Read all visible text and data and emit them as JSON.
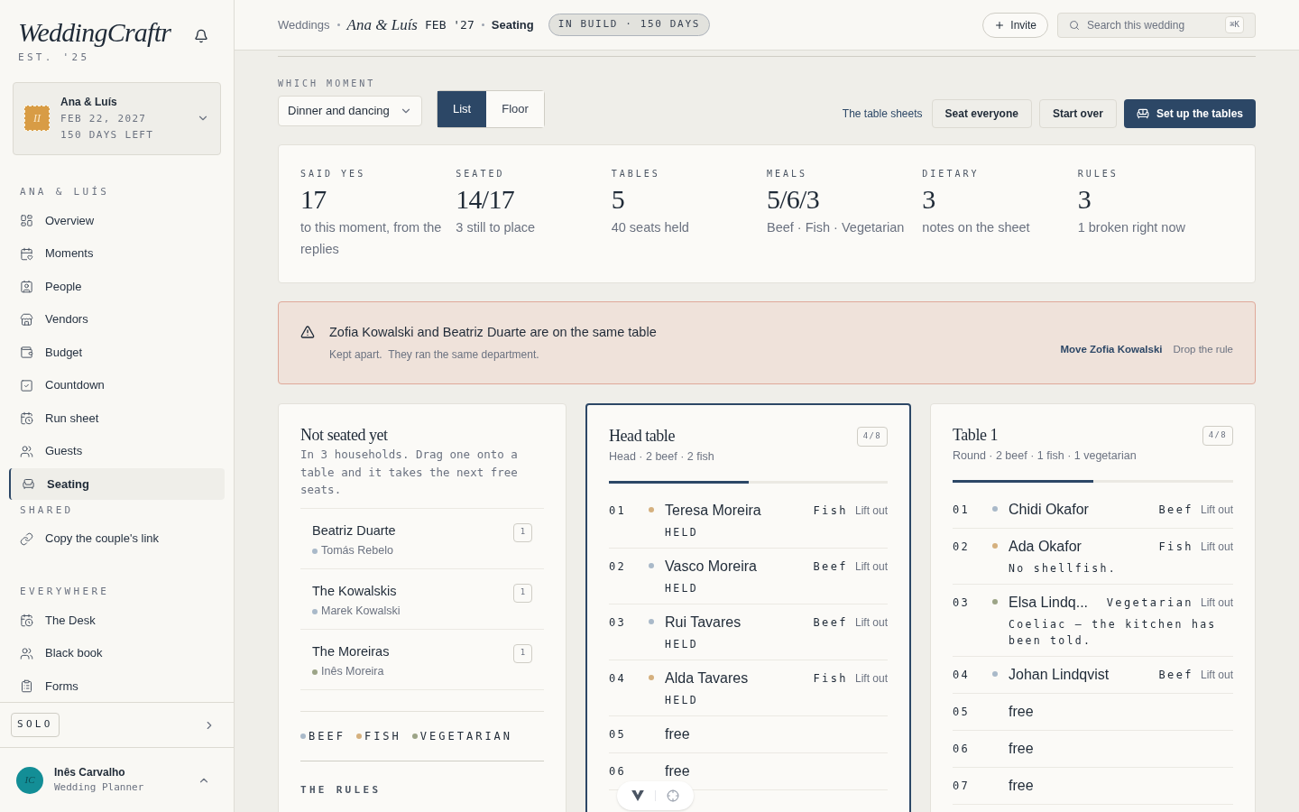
{
  "sidebar": {
    "brand": "WeddingCraftr",
    "est": "EST. '25",
    "wedding": {
      "monogram": "II",
      "couple": "Ana & Luís",
      "date": "FEB 22, 2027",
      "days_left": "150 DAYS LEFT"
    },
    "groups": [
      {
        "heading": "ANA & LUÍS",
        "items": [
          {
            "label": "Overview",
            "selected": false
          },
          {
            "label": "Moments",
            "selected": false
          },
          {
            "label": "People",
            "selected": false
          },
          {
            "label": "Vendors",
            "selected": false
          },
          {
            "label": "Budget",
            "selected": false
          },
          {
            "label": "Countdown",
            "selected": false
          },
          {
            "label": "Run sheet",
            "selected": false
          },
          {
            "label": "Guests",
            "selected": false
          },
          {
            "label": "Seating",
            "selected": true
          }
        ]
      },
      {
        "heading": "SHARED",
        "items": [
          {
            "label": "Copy the couple's link",
            "selected": false
          }
        ]
      },
      {
        "heading": "EVERYWHERE",
        "items": [
          {
            "label": "The Desk",
            "selected": false
          },
          {
            "label": "Black book",
            "selected": false
          },
          {
            "label": "Forms",
            "selected": false
          }
        ]
      }
    ],
    "plan": "SOLO",
    "user": {
      "initials": "IC",
      "name": "Inês Carvalho",
      "role": "Wedding Planner"
    }
  },
  "header": {
    "crumbs": [
      {
        "kind": "link",
        "text": "Weddings"
      },
      {
        "kind": "couple",
        "text": "Ana & Luís"
      },
      {
        "kind": "date",
        "text": "FEB '27"
      },
      {
        "kind": "current",
        "text": "Seating"
      }
    ],
    "badge": "IN BUILD · 150 DAYS",
    "invite": "Invite",
    "search": {
      "placeholder": "Search this wedding",
      "shortcut": "⌘K"
    }
  },
  "toolbar": {
    "label": "WHICH MOMENT",
    "moment": "Dinner and dancing",
    "views": [
      {
        "label": "List",
        "selected": true
      },
      {
        "label": "Floor",
        "selected": false
      }
    ],
    "link": "The table sheets",
    "buttons": [
      {
        "label": "Seat everyone",
        "kind": "plain"
      },
      {
        "label": "Start over",
        "kind": "plain"
      },
      {
        "label": "Set up the tables",
        "kind": "primary"
      }
    ]
  },
  "stats": [
    {
      "label": "SAID YES",
      "value": "17",
      "note": "to this moment, from the replies"
    },
    {
      "label": "SEATED",
      "value": "14/17",
      "note": "3 still to place"
    },
    {
      "label": "TABLES",
      "value": "5",
      "note": "40 seats held"
    },
    {
      "label": "MEALS",
      "value": "5/6/3",
      "note": "Beef · Fish · Vegetarian"
    },
    {
      "label": "DIETARY",
      "value": "3",
      "note": "notes on the sheet"
    },
    {
      "label": "RULES",
      "value": "3",
      "note": "1 broken right now"
    }
  ],
  "alert": {
    "title": "Zofia Kowalski and Beatriz Duarte are on the same table",
    "detail": "Kept apart.  They ran the same department.",
    "actions": [
      {
        "label": "Move Zofia Kowalski",
        "kind": "primary"
      },
      {
        "label": "Drop the rule",
        "kind": "plain"
      }
    ]
  },
  "unseated": {
    "title": "Not seated yet",
    "hint": "In 3 households. Drag one onto a table and it takes the next free seats.",
    "households": [
      {
        "name": "Beatriz Duarte",
        "member": "Tomás Rebelo",
        "color": "#a9b9c9",
        "count": "1"
      },
      {
        "name": "The Kowalskis",
        "member": "Marek Kowalski",
        "color": "#a9b9c9",
        "count": "1"
      },
      {
        "name": "The Moreiras",
        "member": "Inês Moreira",
        "color": "#9ca487",
        "count": "1"
      }
    ],
    "legend": [
      {
        "label": "BEEF",
        "color": "#a9b9c9"
      },
      {
        "label": "FISH",
        "color": "#d5b07e"
      },
      {
        "label": "VEGETARIAN",
        "color": "#9ca487"
      }
    ],
    "rules_heading": "THE RULES"
  },
  "tables": [
    {
      "name": "Head table",
      "subtitle": "Head · 2 beef · 2 fish",
      "count": "4/8",
      "level": 0.5,
      "selected": true,
      "seats": [
        {
          "kind": "guest",
          "number": "01",
          "name": "Teresa Moreira",
          "meal": "Fish",
          "color": "#d5b07e",
          "action": "Lift out",
          "note": "HELD"
        },
        {
          "kind": "guest",
          "number": "02",
          "name": "Vasco Moreira",
          "meal": "Beef",
          "color": "#a9b9c9",
          "action": "Lift out",
          "note": "HELD"
        },
        {
          "kind": "guest",
          "number": "03",
          "name": "Rui Tavares",
          "meal": "Beef",
          "color": "#a9b9c9",
          "action": "Lift out",
          "note": "HELD"
        },
        {
          "kind": "guest",
          "number": "04",
          "name": "Alda Tavares",
          "meal": "Fish",
          "color": "#d5b07e",
          "action": "Lift out",
          "note": "HELD"
        },
        {
          "kind": "free",
          "number": "05",
          "name": "free"
        },
        {
          "kind": "free",
          "number": "06",
          "name": "free"
        }
      ]
    },
    {
      "name": "Table 1",
      "subtitle": "Round · 2 beef · 1 fish · 1 vegetarian",
      "count": "4/8",
      "level": 0.5,
      "selected": false,
      "seats": [
        {
          "kind": "guest",
          "number": "01",
          "name": "Chidi Okafor",
          "meal": "Beef",
          "color": "#a9b9c9",
          "action": "Lift out"
        },
        {
          "kind": "guest",
          "number": "02",
          "name": "Ada Okafor",
          "meal": "Fish",
          "color": "#d5b07e",
          "action": "Lift out",
          "note": "No shellfish."
        },
        {
          "kind": "guest",
          "number": "03",
          "name": "Elsa Lindq...",
          "meal": "Vegetarian",
          "color": "#9ca487",
          "action": "Lift out",
          "note": "Coeliac — the kitchen has been told."
        },
        {
          "kind": "guest",
          "number": "04",
          "name": "Johan Lindqvist",
          "meal": "Beef",
          "color": "#a9b9c9",
          "action": "Lift out"
        },
        {
          "kind": "free",
          "number": "05",
          "name": "free"
        },
        {
          "kind": "free",
          "number": "06",
          "name": "free"
        },
        {
          "kind": "free",
          "number": "07",
          "name": "free"
        }
      ]
    }
  ]
}
